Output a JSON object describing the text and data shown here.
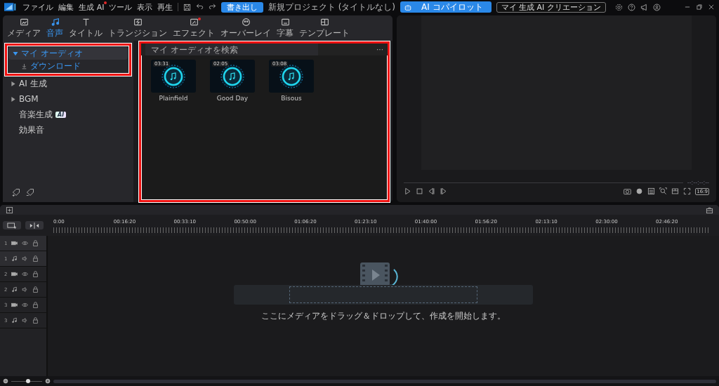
{
  "menu": [
    {
      "label": "ファイル",
      "badge": false
    },
    {
      "label": "編集",
      "badge": false
    },
    {
      "label": "生成 AI",
      "badge": true
    },
    {
      "label": "ツール",
      "badge": false
    },
    {
      "label": "表示",
      "badge": false
    },
    {
      "label": "再生",
      "badge": false
    }
  ],
  "export_button": "書き出し",
  "window": {
    "title": "新規プロジェクト (タイトルなし)"
  },
  "copilot_button": "AI コパイロット",
  "creations_button": "マイ 生成 AI クリエーション",
  "tabs": [
    {
      "label": "メディア",
      "selected": false,
      "badge": false
    },
    {
      "label": "音声",
      "selected": true,
      "badge": false
    },
    {
      "label": "タイトル",
      "selected": false,
      "badge": false
    },
    {
      "label": "トランジション",
      "selected": false,
      "badge": false
    },
    {
      "label": "エフェクト",
      "selected": false,
      "badge": true
    },
    {
      "label": "オーバーレイ",
      "selected": false,
      "badge": false
    },
    {
      "label": "字幕",
      "selected": false,
      "badge": false
    },
    {
      "label": "テンプレート",
      "selected": false,
      "badge": false
    }
  ],
  "library": {
    "highlighted": true,
    "items": [
      {
        "kind": "folder",
        "label": "マイ オーディオ",
        "expanded": true,
        "selected": true,
        "children": [
          {
            "kind": "download",
            "label": "ダウンロード",
            "selected": true
          }
        ]
      },
      {
        "kind": "folder",
        "label": "AI 生成",
        "expanded": false,
        "selected": false
      },
      {
        "kind": "folder",
        "label": "BGM",
        "expanded": false,
        "selected": false
      },
      {
        "kind": "leaf",
        "label": "音楽生成",
        "badge": "AI",
        "selected": false
      },
      {
        "kind": "leaf",
        "label": "効果音",
        "selected": false
      }
    ]
  },
  "media": {
    "highlighted": true,
    "search": {
      "placeholder": "マイ オーディオを検索"
    },
    "more": "···",
    "items": [
      {
        "duration": "03:31",
        "title": "Plainfield"
      },
      {
        "duration": "02:05",
        "title": "Good Day"
      },
      {
        "duration": "03:08",
        "title": "Bisous"
      }
    ]
  },
  "preview": {
    "timecode": "--:--:--:--",
    "aspect": "16:9"
  },
  "timeline": {
    "ruler": [
      "0:00",
      "00:16:20",
      "00:33:10",
      "00:50:00",
      "01:06:20",
      "01:23:10",
      "01:40:00",
      "01:56:20",
      "02:13:10",
      "02:30:00",
      "02:46:20"
    ],
    "tracks": [
      {
        "number": "1",
        "kind": "video",
        "selected": true
      },
      {
        "number": "1",
        "kind": "audio",
        "selected": true
      },
      {
        "number": "2",
        "kind": "video",
        "selected": false
      },
      {
        "number": "2",
        "kind": "audio",
        "selected": false
      },
      {
        "number": "3",
        "kind": "video",
        "selected": false
      },
      {
        "number": "3",
        "kind": "audio",
        "selected": false
      }
    ],
    "hint": "ここにメディアをドラッグ＆ドロップして、作成を開始します。",
    "zoom": {
      "level": 0.55
    }
  }
}
